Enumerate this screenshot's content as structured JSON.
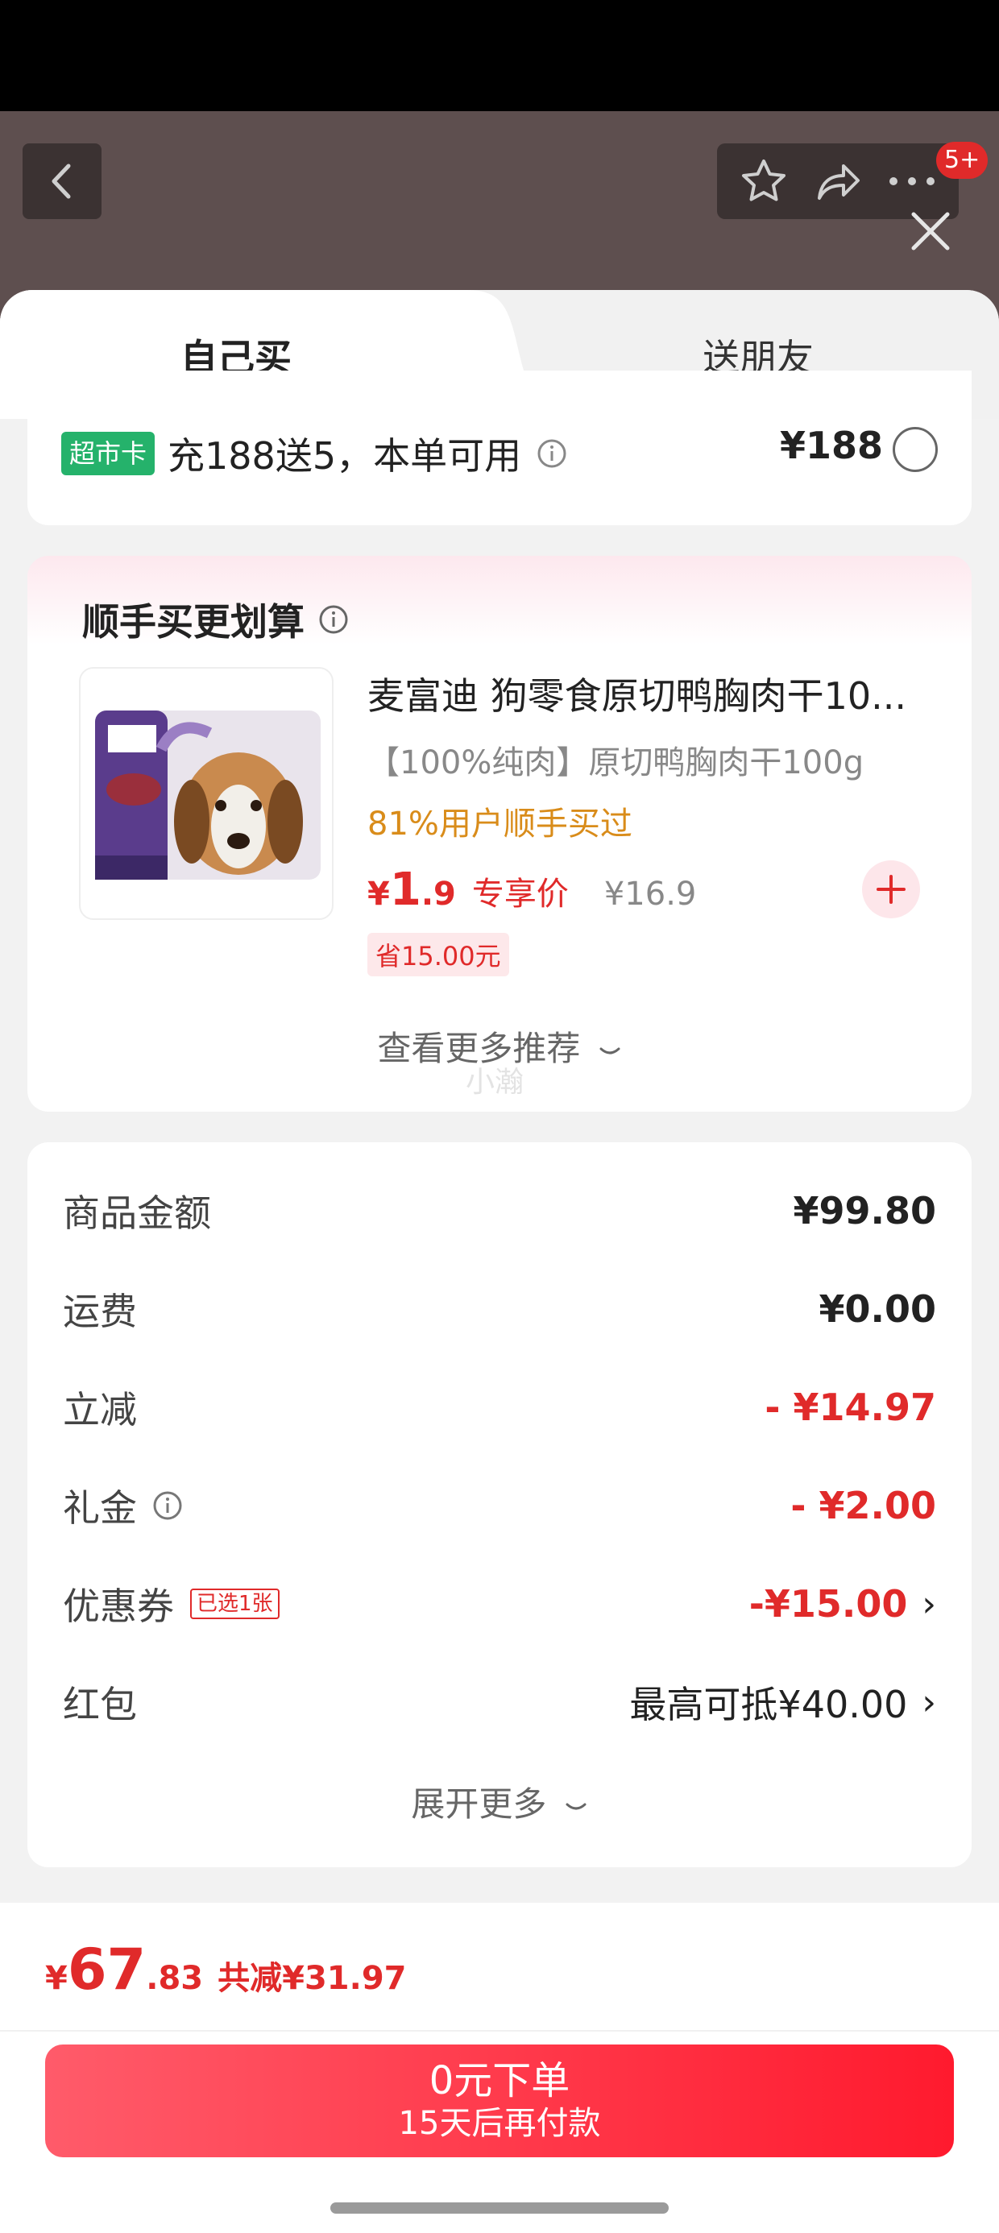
{
  "header": {
    "notification_badge": "5+"
  },
  "tabs": {
    "self": "自己买",
    "friend": "送朋友"
  },
  "supermarket": {
    "tag": "超市卡",
    "text": "充188送5，本单可用",
    "price": "¥188"
  },
  "recommend": {
    "title": "顺手买更划算",
    "product": {
      "name": "麦富迪 狗零食原切鸭胸肉干10...",
      "subtitle": "【100%纯肉】原切鸭胸肉干100g",
      "stat": "81%用户顺手买过",
      "price_yen": "¥",
      "price_int": "1",
      "price_dec": ".9",
      "price_tag": "专享价",
      "original_price": "¥16.9",
      "save": "省15.00元"
    },
    "more": "查看更多推荐",
    "watermark": "小瀚"
  },
  "summary": {
    "rows": [
      {
        "label": "商品金额",
        "value": "¥99.80"
      },
      {
        "label": "运费",
        "value": "¥0.00"
      },
      {
        "label": "立减",
        "value": "- ¥14.97"
      },
      {
        "label": "礼金",
        "value": "- ¥2.00"
      },
      {
        "label": "优惠券",
        "value": "-¥15.00",
        "tag": "已选1张"
      },
      {
        "label": "红包",
        "value": "最高可抵¥40.00"
      }
    ],
    "expand": "展开更多"
  },
  "footer": {
    "total_yen": "¥",
    "total_int": "67",
    "total_dec": ".83",
    "total_reduce": "共减¥31.97",
    "pay_line1": "0元下单",
    "pay_line2": "15天后再付款"
  },
  "colors": {
    "accent_red": "#e02a2a",
    "tag_green": "#25b26b",
    "highlight_orange": "#d98c1a"
  }
}
